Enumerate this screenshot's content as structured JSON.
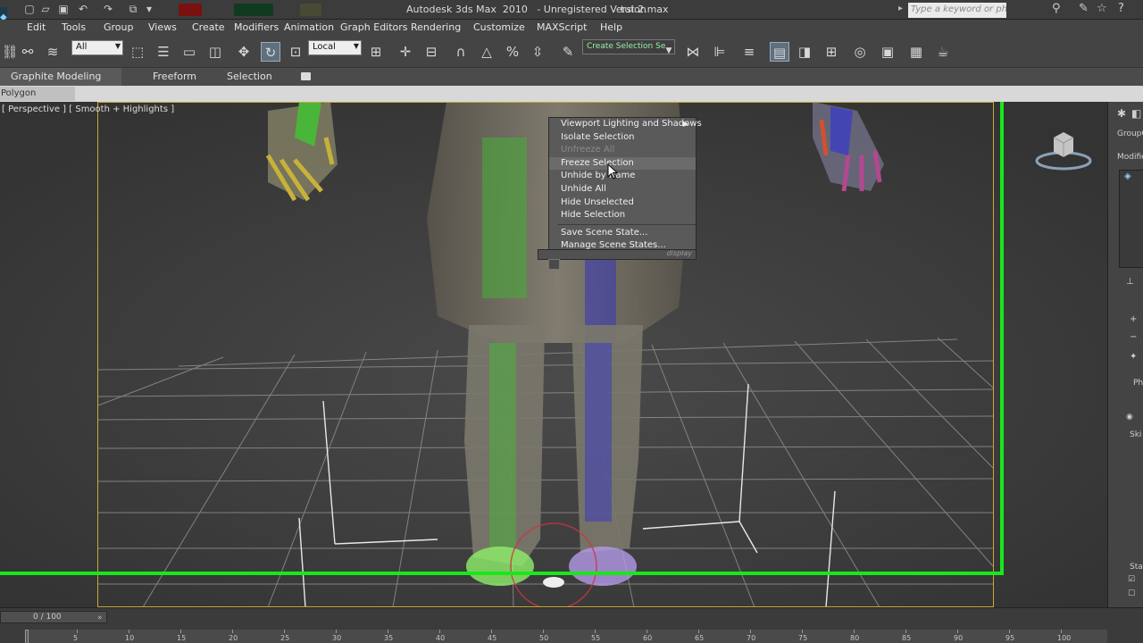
{
  "window": {
    "app_title": "Autodesk 3ds Max  2010   - Unregistered Version",
    "file_title": "tut 2.max",
    "search_placeholder": "Type a keyword or phrase"
  },
  "menubar": {
    "items": [
      "Edit",
      "Tools",
      "Group",
      "Views",
      "Create",
      "Modifiers",
      "Animation",
      "Graph Editors",
      "Rendering",
      "Customize",
      "MAXScript",
      "Help"
    ]
  },
  "toolbar": {
    "selection_filter": "All",
    "reference_coord": "Local",
    "named_selection_placeholder": "Create Selection Se"
  },
  "ribbon": {
    "tabs": [
      "Graphite Modeling Tools",
      "Freeform",
      "Selection"
    ],
    "sub_tab": "Polygon Modeling"
  },
  "viewport": {
    "label_parts": [
      "[ Perspective ]",
      "[ Smooth + Highlights ]"
    ],
    "highlight_color": "#18e81a",
    "frame_color": "#c9a93c"
  },
  "quad_menu": {
    "items": [
      {
        "label": "Viewport Lighting and Shadows",
        "state": "submenu"
      },
      {
        "label": "Isolate Selection",
        "state": "normal"
      },
      {
        "label": "Unfreeze All",
        "state": "disabled"
      },
      {
        "label": "Freeze Selection",
        "state": "hover"
      },
      {
        "label": "Unhide by Name",
        "state": "normal"
      },
      {
        "label": "Unhide All",
        "state": "normal"
      },
      {
        "label": "Hide Unselected",
        "state": "normal"
      },
      {
        "label": "Hide Selection",
        "state": "normal"
      },
      {
        "label": "Save Scene State...",
        "state": "normal"
      },
      {
        "label": "Manage Scene States...",
        "state": "normal"
      }
    ],
    "quadrant_label": "display"
  },
  "command_panel": {
    "labels": [
      "GroupO",
      "Modifie",
      "Ph",
      "Ski",
      "Sta"
    ]
  },
  "timeline": {
    "frame_counter": "0 / 100",
    "ticks": [
      "5",
      "10",
      "15",
      "20",
      "25",
      "30",
      "35",
      "40",
      "45",
      "50",
      "55",
      "60",
      "65",
      "70",
      "75",
      "80",
      "85",
      "90",
      "95",
      "100"
    ]
  }
}
